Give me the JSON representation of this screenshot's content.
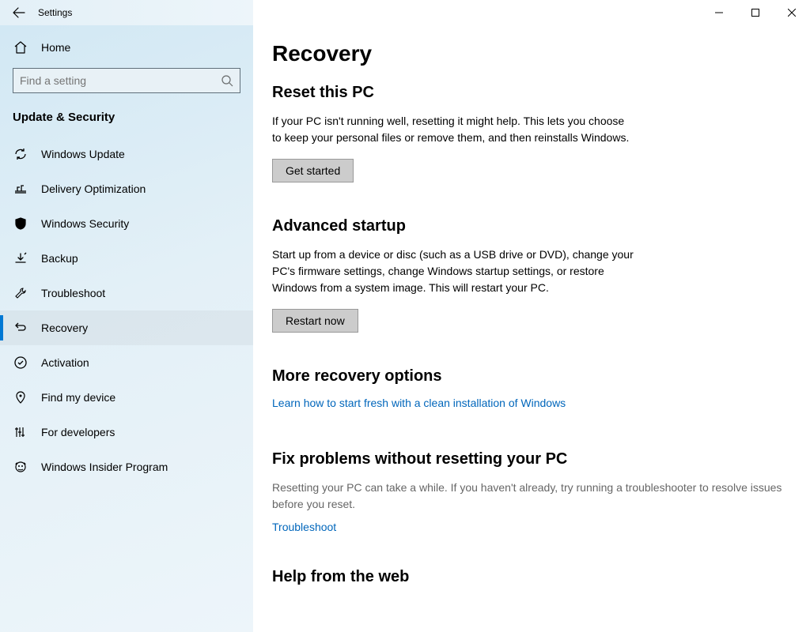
{
  "titlebar": {
    "title": "Settings"
  },
  "sidebar": {
    "home": "Home",
    "search_placeholder": "Find a setting",
    "category": "Update & Security",
    "items": [
      {
        "label": "Windows Update"
      },
      {
        "label": "Delivery Optimization"
      },
      {
        "label": "Windows Security"
      },
      {
        "label": "Backup"
      },
      {
        "label": "Troubleshoot"
      },
      {
        "label": "Recovery"
      },
      {
        "label": "Activation"
      },
      {
        "label": "Find my device"
      },
      {
        "label": "For developers"
      },
      {
        "label": "Windows Insider Program"
      }
    ],
    "active_index": 5
  },
  "content": {
    "page_title": "Recovery",
    "reset": {
      "heading": "Reset this PC",
      "desc": "If your PC isn't running well, resetting it might help. This lets you choose to keep your personal files or remove them, and then reinstalls Windows.",
      "button": "Get started"
    },
    "advanced": {
      "heading": "Advanced startup",
      "desc": "Start up from a device or disc (such as a USB drive or DVD), change your PC's firmware settings, change Windows startup settings, or restore Windows from a system image. This will restart your PC.",
      "button": "Restart now"
    },
    "more": {
      "heading": "More recovery options",
      "link": "Learn how to start fresh with a clean installation of Windows"
    },
    "fix": {
      "heading": "Fix problems without resetting your PC",
      "desc": "Resetting your PC can take a while. If you haven't already, try running a troubleshooter to resolve issues before you reset.",
      "link": "Troubleshoot"
    },
    "help": {
      "heading": "Help from the web"
    }
  }
}
